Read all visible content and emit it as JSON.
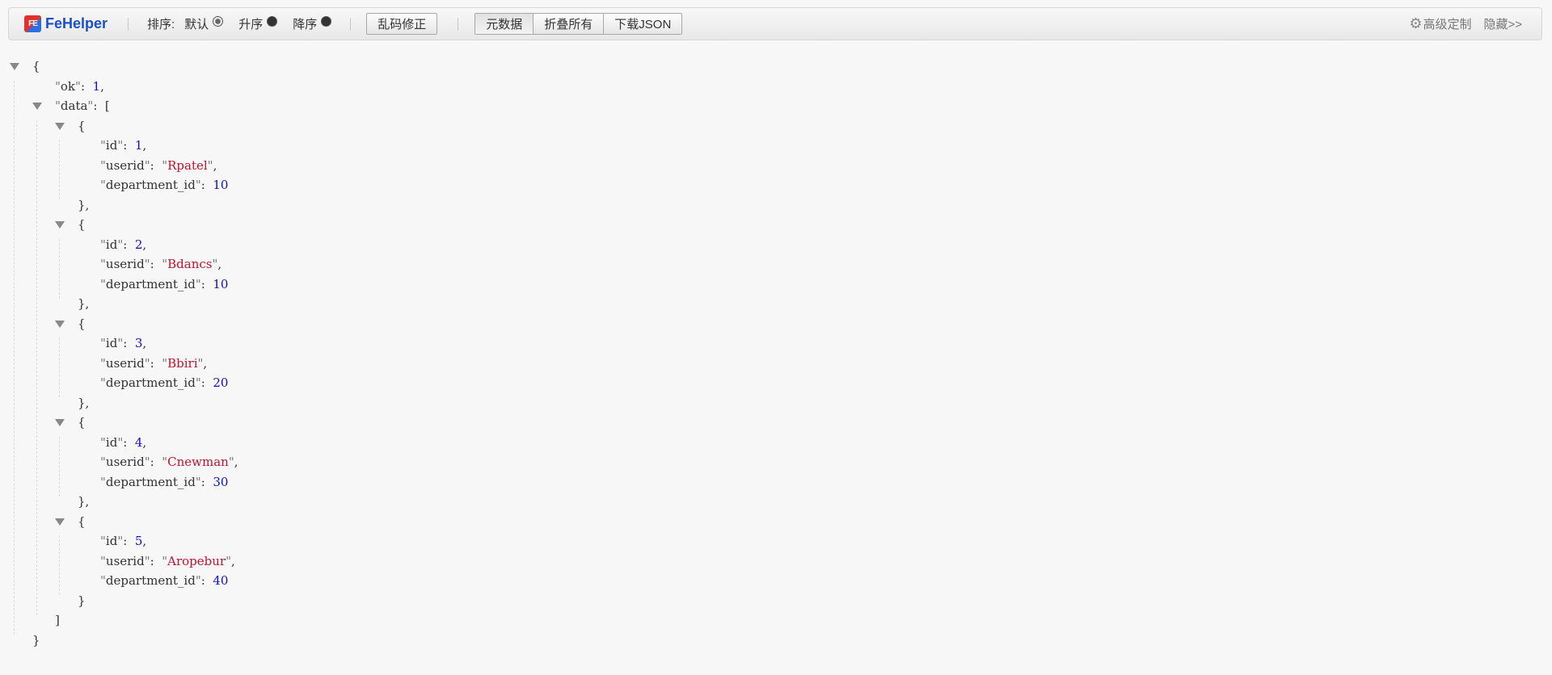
{
  "toolbar": {
    "logo_mark": "FE",
    "logo_text": "FeHelper",
    "sort_label": "排序:",
    "sort_options": [
      {
        "label": "默认",
        "selected": true
      },
      {
        "label": "升序",
        "selected": false
      },
      {
        "label": "降序",
        "selected": false
      }
    ],
    "fix_encoding_label": "乱码修正",
    "meta_label": "元数据",
    "collapse_all_label": "折叠所有",
    "download_json_label": "下载JSON",
    "advanced_label": "高级定制",
    "hide_label": "隐藏>>"
  },
  "json": {
    "ok": 1,
    "data": [
      {
        "id": 1,
        "userid": "Rpatel",
        "department_id": 10
      },
      {
        "id": 2,
        "userid": "Bdancs",
        "department_id": 10
      },
      {
        "id": 3,
        "userid": "Bbiri",
        "department_id": 20
      },
      {
        "id": 4,
        "userid": "Cnewman",
        "department_id": 30
      },
      {
        "id": 5,
        "userid": "Aropebur",
        "department_id": 40
      }
    ]
  },
  "colors": {
    "number": "#1010c8",
    "string": "#c8102e",
    "logo": "#1a4fcf"
  },
  "icons": [
    "fehelper-logo-icon",
    "gear-icon",
    "collapse-triangle-icon"
  ]
}
